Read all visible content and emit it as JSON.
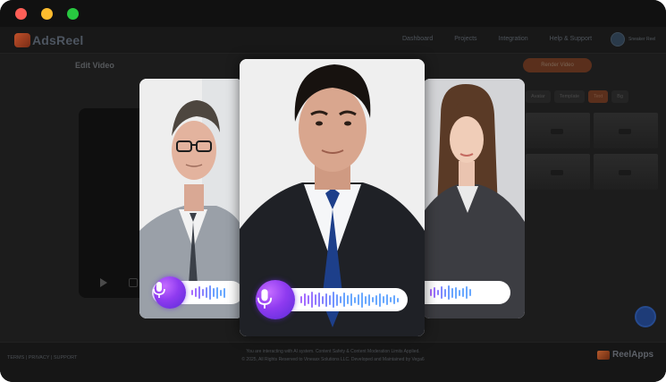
{
  "window": {
    "controls": [
      "close",
      "minimize",
      "maximize"
    ],
    "colors": {
      "close": "#ff5f57",
      "minimize": "#febc2e",
      "maximize": "#28c840"
    }
  },
  "app": {
    "logo_text": "AdsReel",
    "nav": [
      "Dashboard",
      "Projects",
      "Integration",
      "Help & Support"
    ],
    "user_label": "Sneaker Reel",
    "page_title": "Edit Video",
    "render_button": "Render Video",
    "tabs": [
      "Avatar",
      "Template",
      "Text",
      "Bg"
    ],
    "active_tab_index": 2
  },
  "footer": {
    "links": "TERMS | PRIVACY | SUPPORT",
    "line1": "You are interacting with AI system. Content Safety & Content Moderation Limits Applied.",
    "line2": "© 2025, All Rights Reserved to Vineasx Solutions LLC. Developed and Maintained by Vega6",
    "brand": "ReelApps"
  },
  "accent_colors": {
    "mic_gradient_start": "#c46bff",
    "mic_gradient_end": "#5b2bd8",
    "wave_blue": "#6aa9ff",
    "wave_purple": "#a86bff",
    "brand_orange": "#c0502a"
  },
  "icons": [
    "microphone-icon",
    "play-icon",
    "chat-icon"
  ]
}
